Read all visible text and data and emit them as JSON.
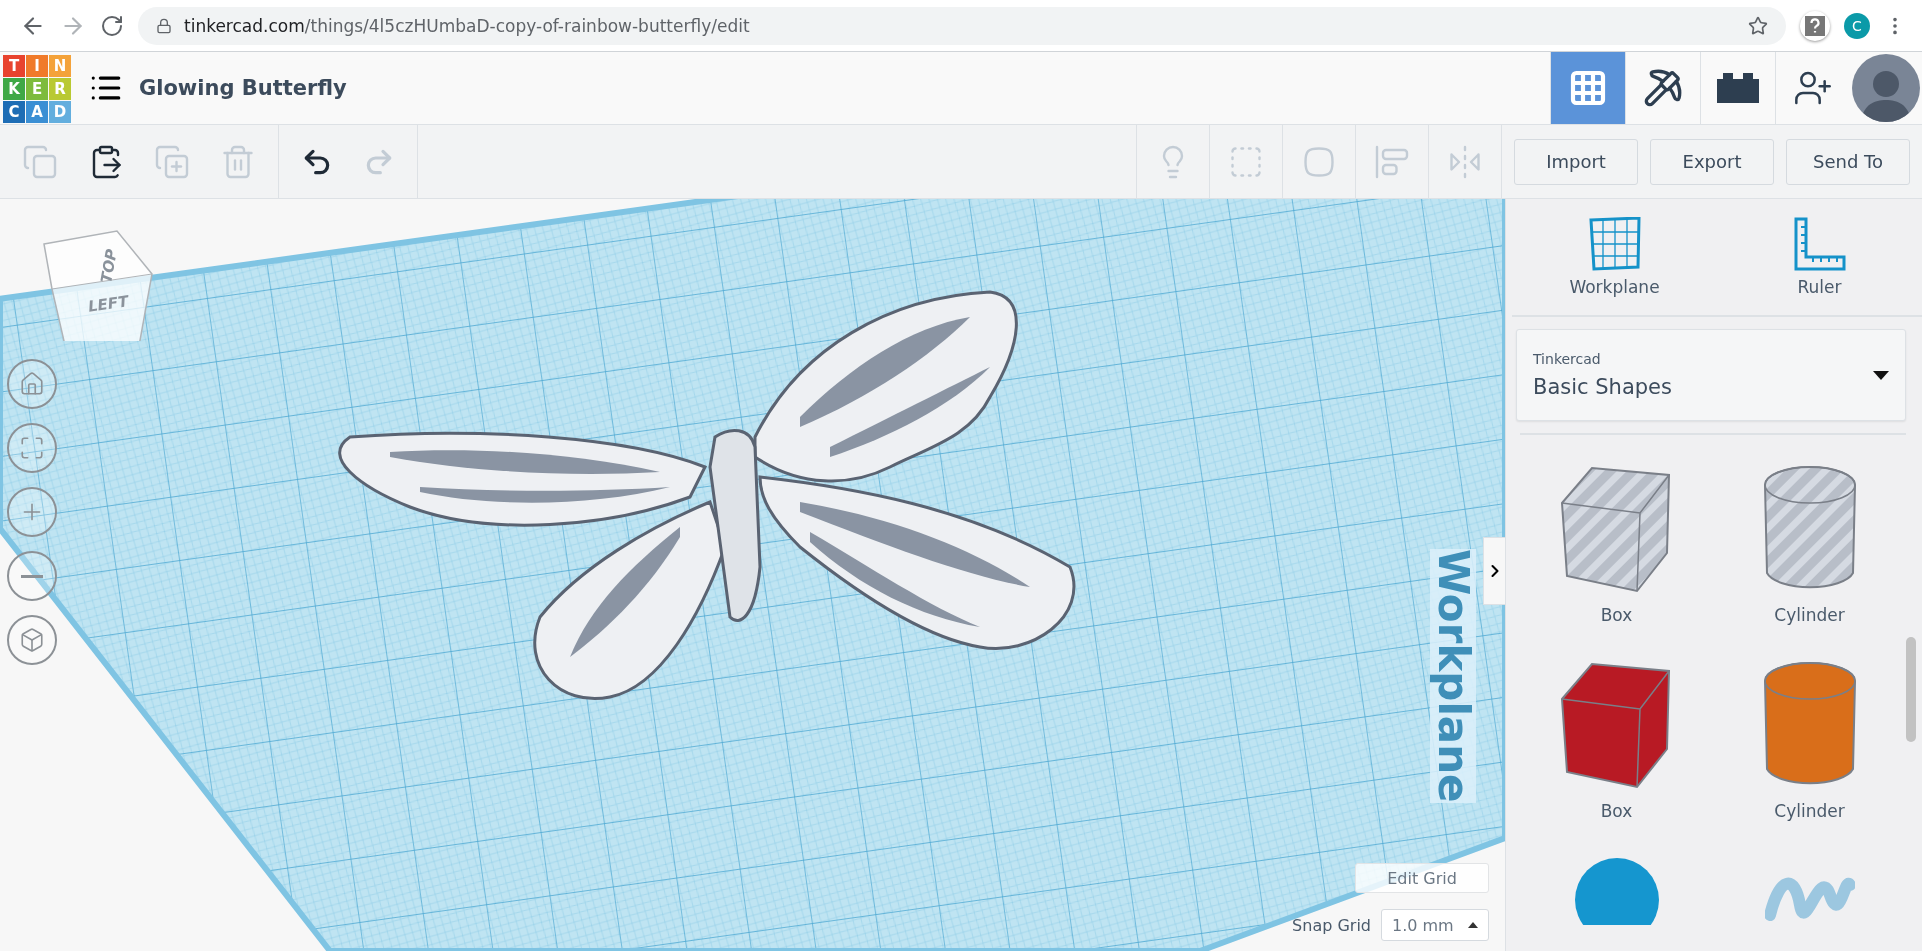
{
  "browser": {
    "url_domain": "tinkercad.com",
    "url_path": "/things/4l5czHUmbaD-copy-of-rainbow-butterfly/edit",
    "profile_initial": "C"
  },
  "app": {
    "logo": [
      {
        "letter": "T",
        "color": "#e8432e"
      },
      {
        "letter": "I",
        "color": "#f07a2a"
      },
      {
        "letter": "N",
        "color": "#f4a23a"
      },
      {
        "letter": "K",
        "color": "#3fa846"
      },
      {
        "letter": "E",
        "color": "#7dbb3c"
      },
      {
        "letter": "R",
        "color": "#b9c932"
      },
      {
        "letter": "C",
        "color": "#1e6db5"
      },
      {
        "letter": "A",
        "color": "#3b8fd4"
      },
      {
        "letter": "D",
        "color": "#63aede"
      }
    ],
    "title": "Glowing Butterfly",
    "nav": [
      {
        "kind": "grid",
        "selected": true
      },
      {
        "kind": "pickaxe",
        "selected": false
      },
      {
        "kind": "brick",
        "selected": false
      },
      {
        "kind": "add-user",
        "selected": false
      },
      {
        "kind": "avatar",
        "selected": false
      }
    ]
  },
  "toolbar": {
    "tools": [
      {
        "kind": "copy",
        "disabled": true
      },
      {
        "kind": "paste",
        "disabled": false
      },
      {
        "kind": "duplicate",
        "disabled": true
      },
      {
        "kind": "delete",
        "disabled": true
      },
      {
        "kind": "undo",
        "disabled": false
      },
      {
        "kind": "redo",
        "disabled": true
      }
    ],
    "view_tools": [
      {
        "kind": "light",
        "disabled": true
      },
      {
        "kind": "group",
        "disabled": true
      },
      {
        "kind": "hole",
        "disabled": true
      },
      {
        "kind": "align",
        "disabled": true
      },
      {
        "kind": "mirror",
        "disabled": true
      }
    ],
    "actions": [
      "Import",
      "Export",
      "Send To"
    ]
  },
  "canvas": {
    "view_cube": {
      "top": "TOP",
      "left": "LEFT"
    },
    "workplane_label": "Workplane",
    "controls": [
      {
        "kind": "home"
      },
      {
        "kind": "fit"
      },
      {
        "kind": "zoom-in"
      },
      {
        "kind": "zoom-out"
      },
      {
        "kind": "perspective"
      }
    ],
    "edit_grid": "Edit Grid",
    "snap_label": "Snap Grid",
    "snap_value": "1.0 mm"
  },
  "panel": {
    "tools": [
      {
        "kind": "workplane",
        "label": "Workplane"
      },
      {
        "kind": "ruler",
        "label": "Ruler"
      }
    ],
    "library": {
      "label": "Tinkercad",
      "value": "Basic Shapes"
    },
    "shapes": [
      {
        "kind": "box-hole",
        "label": "Box"
      },
      {
        "kind": "cylinder-hole",
        "label": "Cylinder"
      },
      {
        "kind": "box",
        "label": "Box"
      },
      {
        "kind": "cylinder",
        "label": "Cylinder"
      },
      {
        "kind": "sphere"
      },
      {
        "kind": "scribble"
      }
    ]
  }
}
